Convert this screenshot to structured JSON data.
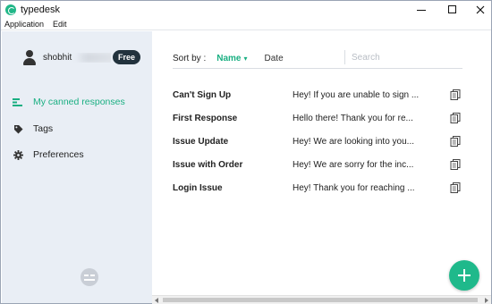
{
  "app": {
    "title": "typedesk",
    "accent": "#1fb98b",
    "sidebar_bg": "#e9eef5"
  },
  "menubar": {
    "items": [
      {
        "label": "Application"
      },
      {
        "label": "Edit"
      }
    ]
  },
  "profile": {
    "username": "shobhit",
    "plan_badge": "Free",
    "avatar_icon": "user-icon"
  },
  "sidebar": {
    "items": [
      {
        "label": "My canned responses",
        "icon": "list-icon",
        "active": true
      },
      {
        "label": "Tags",
        "icon": "tag-icon",
        "active": false
      },
      {
        "label": "Preferences",
        "icon": "gear-icon",
        "active": false
      }
    ],
    "toggle_icon": "collapse-sidebar-icon"
  },
  "sortbar": {
    "label": "Sort by :",
    "options": [
      {
        "label": "Name",
        "active": true
      },
      {
        "label": "Date",
        "active": false
      }
    ],
    "search_placeholder": "Search"
  },
  "responses": [
    {
      "title": "Can't Sign Up",
      "preview": "Hey! If you are unable to sign ..."
    },
    {
      "title": "First Response",
      "preview": "Hello there! Thank you for re..."
    },
    {
      "title": "Issue Update",
      "preview": "Hey! We are looking into you..."
    },
    {
      "title": "Issue with Order",
      "preview": "Hey! We are sorry for the inc..."
    },
    {
      "title": "Login Issue",
      "preview": "Hey! Thank you for reaching ..."
    }
  ],
  "fab": {
    "icon": "plus-icon"
  }
}
